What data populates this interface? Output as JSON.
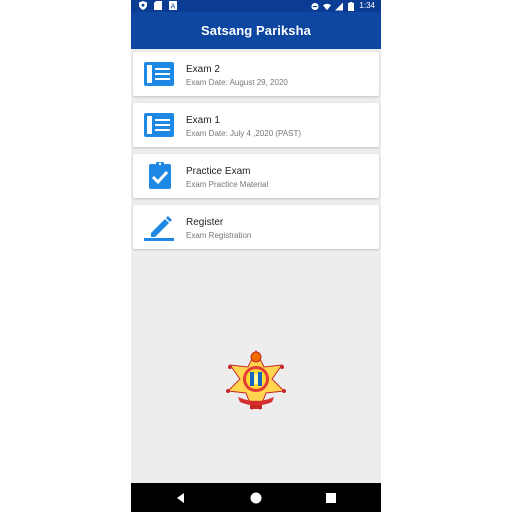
{
  "status_bar": {
    "time": "1:34",
    "left_icons": [
      "shield-icon",
      "sd-card-icon",
      "translate-icon"
    ],
    "right_icons": [
      "do-not-disturb-icon",
      "wifi-icon",
      "signal-icon",
      "battery-icon"
    ]
  },
  "app_bar": {
    "title": "Satsang Pariksha"
  },
  "menu": {
    "items": [
      {
        "title": "Exam 2",
        "subtitle": "Exam Date: August 29, 2020",
        "icon": "document-icon"
      },
      {
        "title": "Exam 1",
        "subtitle": "Exam Date: July 4 ,2020 (PAST)",
        "icon": "document-icon"
      },
      {
        "title": "Practice Exam",
        "subtitle": "Exam Practice Material",
        "icon": "clipboard-check-icon"
      },
      {
        "title": "Register",
        "subtitle": "Exam Registration",
        "icon": "pencil-icon"
      }
    ]
  },
  "nav_bar": {
    "buttons": [
      "back-icon",
      "home-icon",
      "recents-icon"
    ]
  },
  "colors": {
    "primary": "#0d47a1",
    "status_bar": "#0b3c93",
    "icon_blue": "#1e88e5",
    "background": "#ededed"
  }
}
